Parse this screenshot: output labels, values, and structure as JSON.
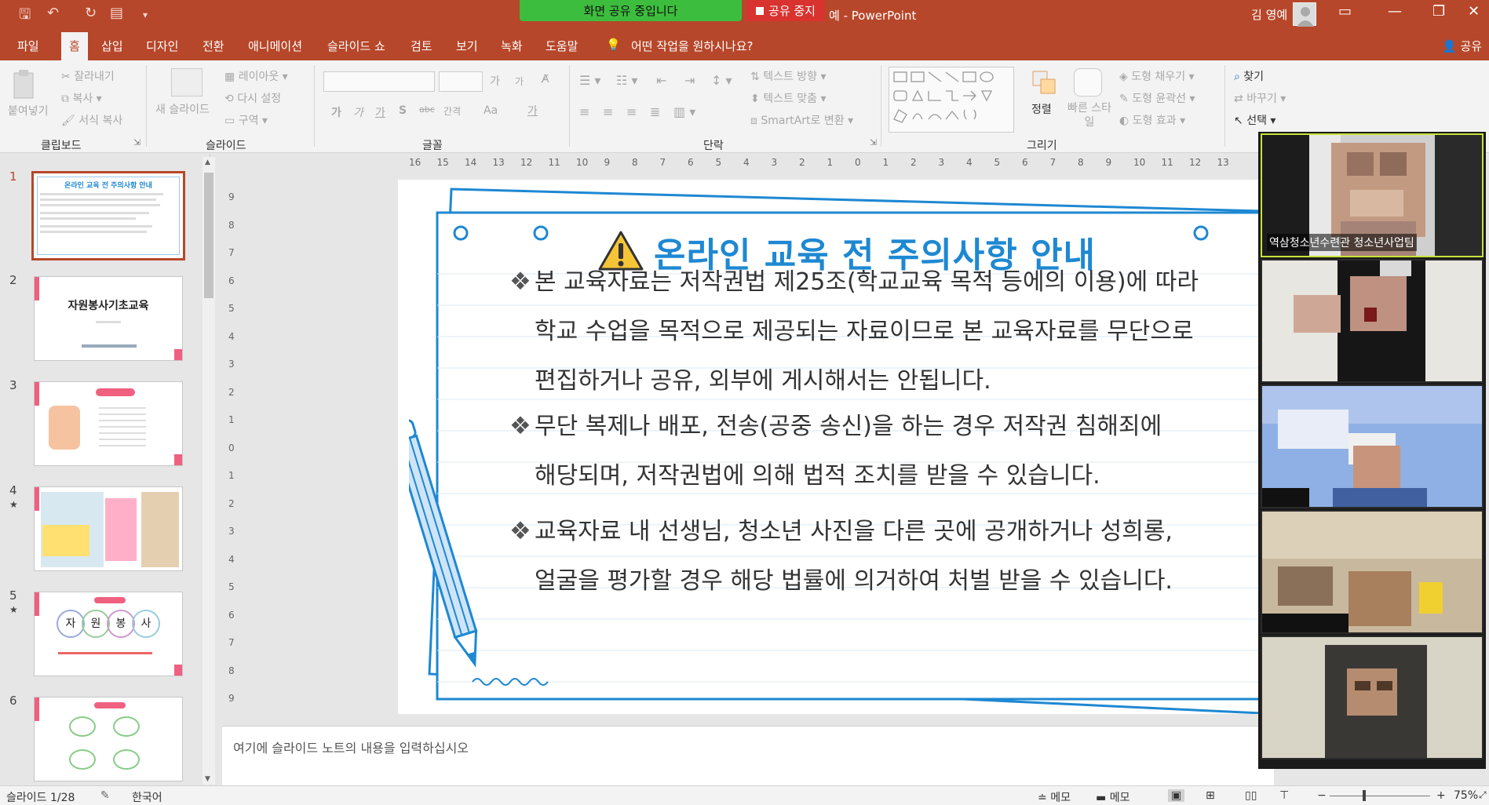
{
  "titlebar": {
    "share_status": "화면 공유 중입니다",
    "share_stop": "공유 중지",
    "doc_title_fragment": "예",
    "app_name": "PowerPoint",
    "user_name": "김 영예"
  },
  "tabs": [
    "파일",
    "홈",
    "삽입",
    "디자인",
    "전환",
    "애니메이션",
    "슬라이드 쇼",
    "검토",
    "보기",
    "녹화",
    "도움말"
  ],
  "tell_me": "어떤 작업을 원하시나요?",
  "share_button": "공유",
  "ribbon": {
    "clipboard": {
      "paste": "붙여넣기",
      "cut": "잘라내기",
      "copy": "복사",
      "format_painter": "서식 복사",
      "label": "클립보드"
    },
    "slides": {
      "new_slide": "새 슬라이드",
      "layout": "레이아웃",
      "reset": "다시 설정",
      "section": "구역",
      "label": "슬라이드"
    },
    "font": {
      "label": "글꼴",
      "bold": "가",
      "italic": "가",
      "underline": "가",
      "shadow": "S",
      "strike": "abc",
      "spacing": "간격",
      "case": "Aa",
      "grow": "가",
      "shrink": "가",
      "color": "가"
    },
    "paragraph": {
      "text_direction": "텍스트 방향",
      "align_text": "텍스트 맞춤",
      "smartart": "SmartArt로 변환",
      "label": "단락"
    },
    "drawing": {
      "arrange": "정렬",
      "quick_styles": "빠른 스타일",
      "shape_fill": "도형 채우기",
      "shape_outline": "도형 윤곽선",
      "shape_effects": "도형 효과",
      "label": "그리기"
    },
    "editing": {
      "find": "찾기",
      "replace": "바꾸기",
      "select": "선택"
    }
  },
  "slides": [
    {
      "num": "1",
      "star": false
    },
    {
      "num": "2",
      "star": false,
      "title": "자원봉사기초교육"
    },
    {
      "num": "3",
      "star": false
    },
    {
      "num": "4",
      "star": true
    },
    {
      "num": "5",
      "star": true,
      "circles": [
        "자",
        "원",
        "봉",
        "사"
      ]
    },
    {
      "num": "6",
      "star": false
    }
  ],
  "slide": {
    "title": "온라인 교육 전 주의사항 안내",
    "bullets": [
      {
        "line1": "본 교육자료는 저작권법 제25조(학교교육 목적 등에의 이용)에 따라",
        "line2": "학교 수업을 목적으로 제공되는 자료이므로 본 교육자료를 무단으로",
        "line3": "편집하거나 공유, 외부에 게시해서는 안됩니다."
      },
      {
        "line1": "무단 복제나 배포, 전송(공중 송신)을 하는 경우 저작권 침해죄에",
        "line2": "해당되며, 저작권법에 의해 법적 조치를 받을 수 있습니다."
      },
      {
        "line1": "교육자료 내 선생님, 청소년 사진을 다른 곳에 공개하거나 성희롱,",
        "line2": "얼굴을 평가할 경우 해당 법률에 의거하여 처벌 받을 수 있습니다."
      }
    ],
    "bullet_glyph": "❖"
  },
  "ruler_h": [
    "16",
    "15",
    "14",
    "13",
    "12",
    "11",
    "10",
    "9",
    "8",
    "7",
    "6",
    "5",
    "4",
    "3",
    "2",
    "1",
    "0",
    "1",
    "2",
    "3",
    "4",
    "5",
    "6",
    "7",
    "8",
    "9",
    "10",
    "11",
    "12",
    "13"
  ],
  "ruler_v": [
    "9",
    "8",
    "7",
    "6",
    "5",
    "4",
    "3",
    "2",
    "1",
    "0",
    "1",
    "2",
    "3",
    "4",
    "5",
    "6",
    "7",
    "8",
    "9"
  ],
  "notes_placeholder": "여기에 슬라이드 노트의 내용을 입력하십시오",
  "video": {
    "active_label": "역삼청소년수련관 청소년사업팀"
  },
  "status": {
    "slide_counter": "슬라이드 1/28",
    "language": "한국어",
    "notes": "메모",
    "comments": "메모",
    "zoom": "75%"
  },
  "colors": {
    "accent": "#b7472a",
    "slide_blue": "#1e88d2",
    "share_green": "#3dbd3d",
    "stop_red": "#d8332f"
  }
}
